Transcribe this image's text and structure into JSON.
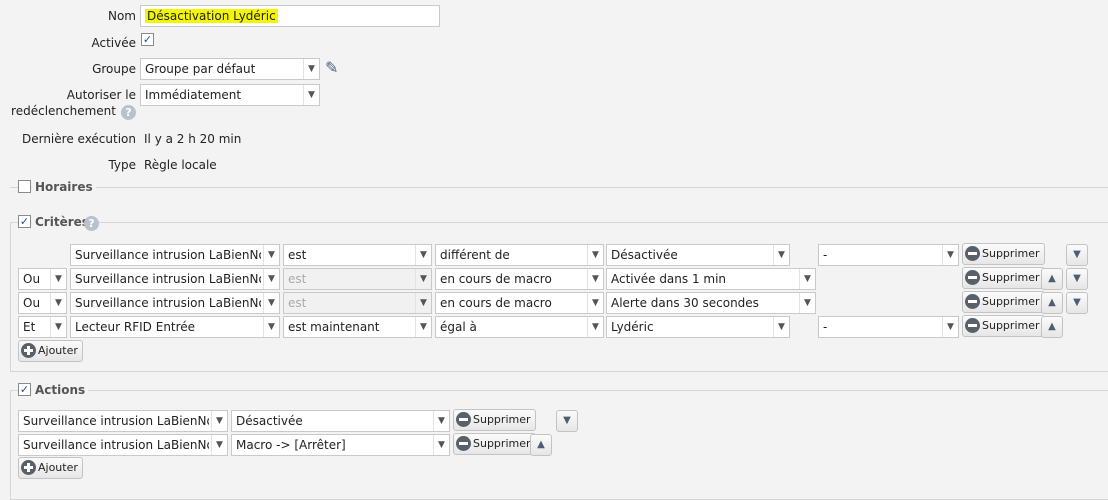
{
  "form": {
    "nom_label": "Nom",
    "nom_value": "Désactivation Lydéric",
    "activee_label": "Activée",
    "activee_checked": "✓",
    "groupe_label": "Groupe",
    "groupe_value": "Groupe par défaut",
    "autoriser_label_1": "Autoriser le",
    "autoriser_label_2": "redéclenchement",
    "autoriser_value": "Immédiatement",
    "derniere_label": "Dernière exécution",
    "derniere_value": "Il y a 2 h 20 min",
    "type_label": "Type",
    "type_value": "Règle locale"
  },
  "sections": {
    "horaires": "Horaires",
    "criteres": "Critères",
    "actions": "Actions",
    "check": "✓"
  },
  "icons": {
    "help": "?",
    "pencil": "✎",
    "dropdown": "▼",
    "up": "▲",
    "down": "▼"
  },
  "buttons": {
    "supprimer": "Supprimer",
    "ajouter": "Ajouter"
  },
  "criteria": [
    {
      "conj": "",
      "device": "Surveillance intrusion LaBienNomm",
      "op": "est",
      "cmp": "différent de",
      "value": "Désactivée",
      "extra": "-"
    },
    {
      "conj": "Ou",
      "device": "Surveillance intrusion LaBienNomm",
      "op": "est",
      "cmp": "en cours de macro",
      "value": "Activée dans 1 min",
      "extra": ""
    },
    {
      "conj": "Ou",
      "device": "Surveillance intrusion LaBienNomm",
      "op": "est",
      "cmp": "en cours de macro",
      "value": "Alerte dans 30 secondes",
      "extra": ""
    },
    {
      "conj": "Et",
      "device": "Lecteur RFID Entrée",
      "op": "est maintenant",
      "cmp": "égal à",
      "value": "Lydéric",
      "extra": "-"
    }
  ],
  "actions": [
    {
      "device": "Surveillance intrusion LaBienNomm",
      "value": "Désactivée"
    },
    {
      "device": "Surveillance intrusion LaBienNomm",
      "value": "Macro -> [Arrêter]"
    }
  ],
  "colors": {
    "highlight": "#f3f600",
    "accent": "#4d5d72"
  }
}
